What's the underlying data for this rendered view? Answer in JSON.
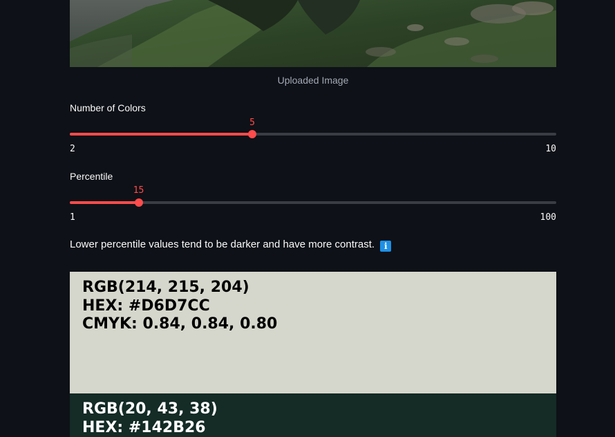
{
  "image": {
    "caption": "Uploaded Image"
  },
  "slider_colors": {
    "label": "Number of Colors",
    "value": 5,
    "value_text": "5",
    "min": 2,
    "max": 10,
    "min_text": "2",
    "max_text": "10"
  },
  "slider_percentile": {
    "label": "Percentile",
    "value": 15,
    "value_text": "15",
    "min": 1,
    "max": 100,
    "min_text": "1",
    "max_text": "100"
  },
  "info": {
    "text": "Lower percentile values tend to be darker and have more contrast.",
    "icon": "info-icon",
    "icon_glyph": "i"
  },
  "colors": [
    {
      "rgb": "RGB(214, 215, 204)",
      "hex": "HEX: #D6D7CC",
      "cmyk": "CMYK: 0.84, 0.84, 0.80",
      "bg": "#D6D7CC",
      "fg": "#000000"
    },
    {
      "rgb": "RGB(20, 43, 38)",
      "hex": "HEX: #142B26",
      "cmyk": "",
      "bg": "#142B26",
      "fg": "#FFFFFF"
    }
  ],
  "theme": {
    "accent": "#ff4b4b",
    "background": "#0e1117",
    "track": "#3b3d45",
    "info_icon_bg": "#1e90e6"
  }
}
